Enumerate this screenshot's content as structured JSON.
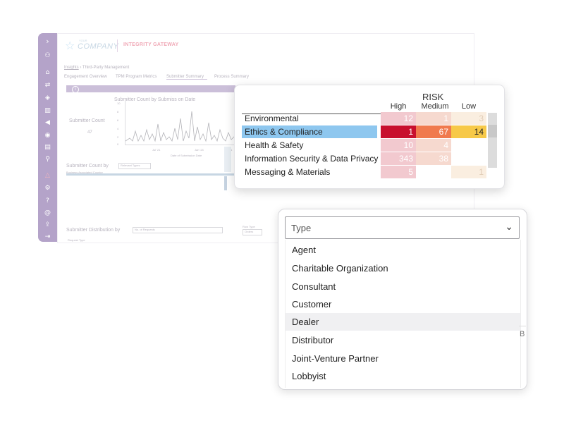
{
  "sidebar": {
    "icons": [
      "chevron-right-icon",
      "people-icon",
      "home-icon",
      "arrows-icon",
      "shield-icon",
      "building-icon",
      "megaphone-icon",
      "eye-icon",
      "document-icon",
      "search-icon",
      "warning-icon",
      "settings-icon",
      "help-icon",
      "at-icon",
      "upload-icon",
      "logout-icon"
    ]
  },
  "header": {
    "logo_small": "YOUR",
    "logo": "COMPANY",
    "brand": "INTEGRITY GATEWAY"
  },
  "breadcrumb": {
    "root": "Insights",
    "sep": "›",
    "current": "Third-Party Management"
  },
  "tabs": [
    "Engagement Overview",
    "TPM Program Metrics",
    "Submitter Summary",
    "Process Summary"
  ],
  "background_dashboard": {
    "chart_title": "Submitter Count by Submiss on Date",
    "submitter_count_label": "Submitter Count",
    "submitter_count_value": "47",
    "y_ticks": [
      "10",
      "8",
      "6",
      "4",
      "2",
      "0"
    ],
    "x_ticks": [
      "Jul '21",
      "Jan '24",
      "Jul '21"
    ],
    "x_label": "Date of Submission Date",
    "count_by_label": "Submitter Count by",
    "count_by_value": "Relevant Types",
    "business_label": "Business Associated Country",
    "distribution_label": "Submitter Distribution by",
    "distribution_value": "No. of Requests",
    "row_type_label": "Row Type",
    "row_type_value": "Orders",
    "request_type_label": "Request Type"
  },
  "risk_table": {
    "title": "RISK",
    "columns": [
      "High",
      "Medium",
      "Low"
    ],
    "rows": [
      {
        "label": "Environmental",
        "high": "12",
        "medium": "1",
        "low": "3"
      },
      {
        "label": "Ethics & Compliance",
        "high": "1",
        "medium": "67",
        "low": "14"
      },
      {
        "label": "Health & Safety",
        "high": "10",
        "medium": "4",
        "low": ""
      },
      {
        "label": "Information Security & Data Privacy",
        "high": "343",
        "medium": "38",
        "low": ""
      },
      {
        "label": "Messaging & Materials",
        "high": "5",
        "medium": "",
        "low": "1"
      }
    ],
    "colors": {
      "high_faint": "#f2c9cf",
      "medium_faint": "#f6d9cf",
      "low_faint": "#faeee0",
      "high_strong": "#c8102e",
      "medium_strong": "#f07a4e",
      "low_strong": "#f7c948",
      "selected_row": "#8ec7ef"
    }
  },
  "type_dropdown": {
    "placeholder": "Type",
    "options": [
      "Agent",
      "Charitable Organization",
      "Consultant",
      "Customer",
      "Dealer",
      "Distributor",
      "Joint-Venture Partner",
      "Lobbyist"
    ],
    "hovered": "Dealer"
  },
  "peek_text": "B"
}
